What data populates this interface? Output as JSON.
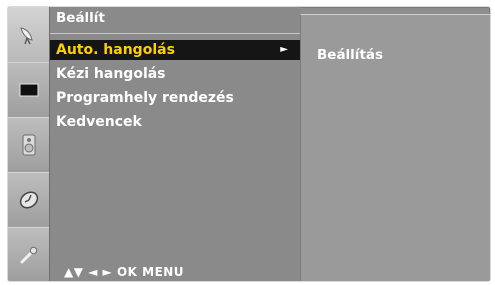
{
  "menu": {
    "title": "Beállít",
    "items": [
      {
        "label": "Auto. hangolás",
        "selected": true
      },
      {
        "label": "Kézi hangolás"
      },
      {
        "label": "Programhely rendezés"
      },
      {
        "label": "Kedvencek"
      }
    ],
    "submenu_arrow": "►",
    "nav_hint": "▲▼  ◄ ►  OK  MENU"
  },
  "submenu": {
    "item": "Beállítás"
  },
  "sidebar": {
    "icons": [
      "satellite-dish-icon",
      "screen-icon",
      "speaker-icon",
      "clock-icon",
      "wrench-icon"
    ]
  },
  "colors": {
    "selected_text": "#ffd000",
    "selected_bg": "#151515",
    "text": "#ffffff"
  }
}
